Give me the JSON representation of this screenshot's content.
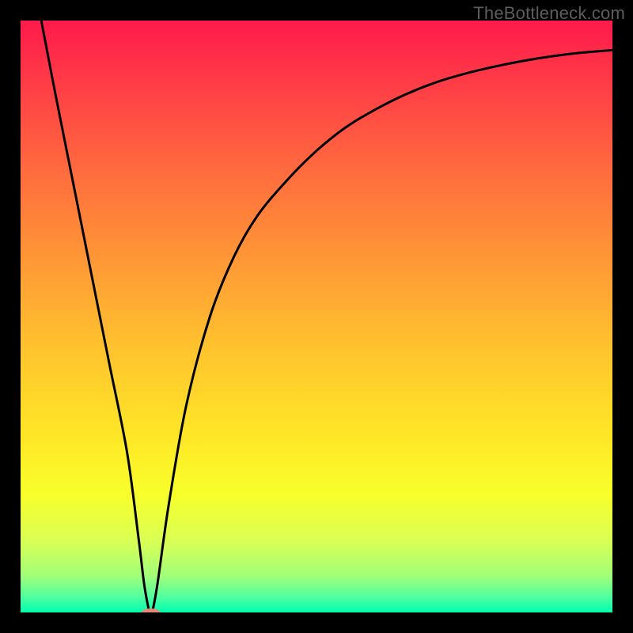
{
  "watermark": "TheBottleneck.com",
  "chart_data": {
    "type": "line",
    "title": "",
    "xlabel": "",
    "ylabel": "",
    "xlim": [
      0,
      100
    ],
    "ylim": [
      0,
      100
    ],
    "series": [
      {
        "name": "curve",
        "x": [
          3.5,
          6,
          9,
          12,
          15,
          18,
          20,
          21,
          22,
          23,
          25,
          28,
          32,
          36,
          40,
          45,
          50,
          55,
          60,
          65,
          70,
          75,
          80,
          85,
          90,
          95,
          100
        ],
        "y": [
          100,
          87,
          72,
          57,
          42,
          27,
          12,
          4,
          0,
          4,
          18,
          35,
          50,
          60,
          67,
          73,
          78,
          82,
          85,
          87.5,
          89.5,
          91,
          92.2,
          93.2,
          94,
          94.6,
          95
        ]
      }
    ],
    "marker": {
      "x": 22,
      "y": 0,
      "color": "#e48a7a",
      "rx": 12,
      "ry": 5
    },
    "gradient_stops": [
      {
        "offset": 0.0,
        "color": "#ff1a4b"
      },
      {
        "offset": 0.1,
        "color": "#ff3a47"
      },
      {
        "offset": 0.25,
        "color": "#ff6a3e"
      },
      {
        "offset": 0.4,
        "color": "#ff9636"
      },
      {
        "offset": 0.55,
        "color": "#ffc22e"
      },
      {
        "offset": 0.7,
        "color": "#ffe627"
      },
      {
        "offset": 0.8,
        "color": "#f8ff2a"
      },
      {
        "offset": 0.88,
        "color": "#d9ff55"
      },
      {
        "offset": 0.94,
        "color": "#9fff7a"
      },
      {
        "offset": 0.975,
        "color": "#4dffa0"
      },
      {
        "offset": 1.0,
        "color": "#00ffb0"
      }
    ]
  }
}
